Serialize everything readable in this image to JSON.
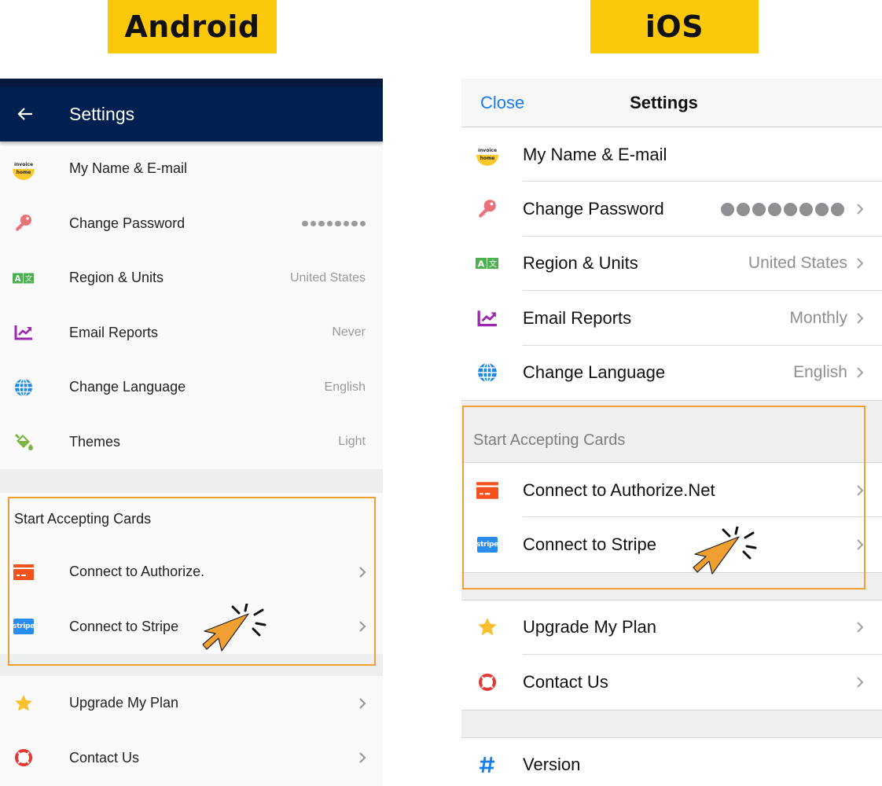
{
  "labels": {
    "android": "Android",
    "ios": "iOS"
  },
  "colors": {
    "label_bg": "#fcc80a",
    "android_appbar": "#002050",
    "ios_link": "#1a7cf5",
    "highlight": "#f0a030",
    "cursor": "#f0a030"
  },
  "android": {
    "header": {
      "back_icon": "arrow-left-icon",
      "title": "Settings"
    },
    "items": [
      {
        "label": "My Name & E-mail",
        "icon": "invoice-home-logo-icon",
        "value": ""
      },
      {
        "label": "Change Password",
        "icon": "key-icon",
        "value": "••••••••",
        "masked": true
      },
      {
        "label": "Region & Units",
        "icon": "translate-icon",
        "value": "United States"
      },
      {
        "label": "Email Reports",
        "icon": "chart-trend-icon",
        "value": "Never"
      },
      {
        "label": "Change Language",
        "icon": "globe-icon",
        "value": "English"
      },
      {
        "label": "Themes",
        "icon": "paint-bucket-icon",
        "value": "Light"
      }
    ],
    "cards_section": {
      "title": "Start Accepting Cards",
      "items": [
        {
          "label": "Connect to Authorize.",
          "icon": "credit-card-icon"
        },
        {
          "label": "Connect to Stripe",
          "icon": "stripe-logo-icon",
          "logo_text": "stripe"
        }
      ]
    },
    "bottom_items": [
      {
        "label": "Upgrade My Plan",
        "icon": "star-icon"
      },
      {
        "label": "Contact Us",
        "icon": "lifebuoy-icon"
      }
    ]
  },
  "ios": {
    "header": {
      "close_label": "Close",
      "title": "Settings"
    },
    "items": [
      {
        "label": "My Name & E-mail",
        "icon": "invoice-home-logo-icon",
        "value": ""
      },
      {
        "label": "Change Password",
        "icon": "key-icon",
        "value": "••••••••",
        "masked": true
      },
      {
        "label": "Region & Units",
        "icon": "translate-icon",
        "value": "United States"
      },
      {
        "label": "Email Reports",
        "icon": "chart-trend-icon",
        "value": "Monthly"
      },
      {
        "label": "Change Language",
        "icon": "globe-icon",
        "value": "English"
      }
    ],
    "cards_section": {
      "title": "Start Accepting Cards",
      "items": [
        {
          "label": "Connect to Authorize.Net",
          "icon": "credit-card-icon"
        },
        {
          "label": "Connect to Stripe",
          "icon": "stripe-logo-icon",
          "logo_text": "stripe"
        }
      ]
    },
    "bottom_items": [
      {
        "label": "Upgrade My Plan",
        "icon": "star-icon"
      },
      {
        "label": "Contact Us",
        "icon": "lifebuoy-icon"
      }
    ],
    "footer_items": [
      {
        "label": "Version",
        "icon": "hash-icon"
      }
    ]
  },
  "logo": {
    "top_text": "invoice",
    "bottom_text": "home"
  }
}
